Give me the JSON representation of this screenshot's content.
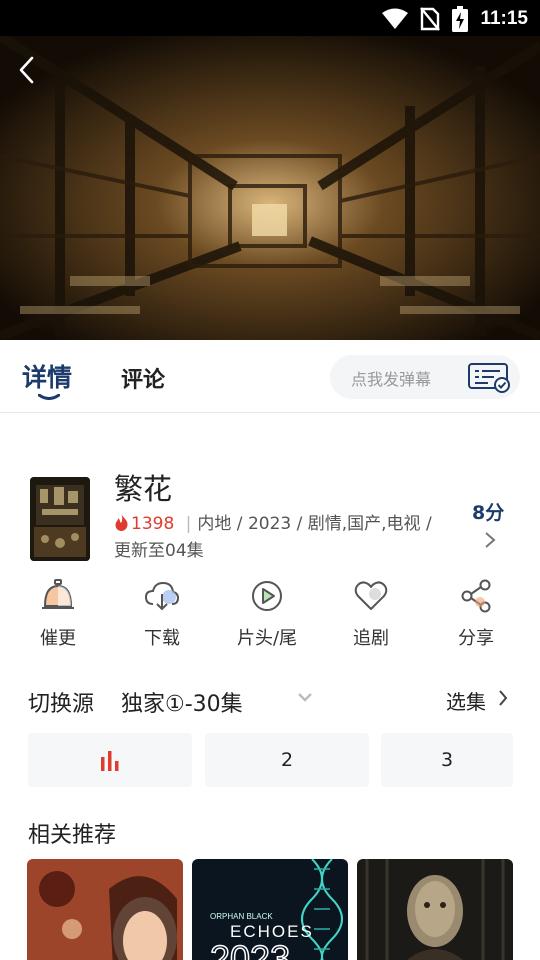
{
  "status_bar": {
    "time": "11:15",
    "icons": [
      "wifi-icon",
      "no-sim-icon",
      "battery-charging-icon"
    ]
  },
  "player": {
    "back_icon": "chevron-left-icon"
  },
  "tabs": [
    {
      "label": "详情",
      "active": true
    },
    {
      "label": "评论",
      "active": false
    }
  ],
  "danmaku": {
    "placeholder": "点我发弹幕",
    "icon": "danmaku-settings-icon"
  },
  "show": {
    "title": "繁花",
    "heat": "1398",
    "meta": "内地 / 2023 / 剧情,国产,电视 /",
    "update_status": "更新至04集",
    "score_label": "8分"
  },
  "actions": [
    {
      "label": "催更",
      "icon": "bell-icon"
    },
    {
      "label": "下载",
      "icon": "cloud-download-icon"
    },
    {
      "label": "片头/尾",
      "icon": "play-circle-icon"
    },
    {
      "label": "追剧",
      "icon": "heart-icon"
    },
    {
      "label": "分享",
      "icon": "share-icon"
    }
  ],
  "source": {
    "label": "切换源",
    "value": "独家①-30集",
    "choose_label": "选集"
  },
  "episodes": [
    {
      "label": "",
      "playing": true,
      "icon": "playing-bars-icon"
    },
    {
      "label": "2"
    },
    {
      "label": "3"
    }
  ],
  "recommended": {
    "title": "相关推荐",
    "card2_caption_small": "ORPHAN BLACK",
    "card2_caption": "ECHOES",
    "card2_number": "2023"
  },
  "colors": {
    "accent_dark_blue": "#1c3a6b",
    "heat_red": "#e03b2e",
    "action_orange": "#f0a070"
  }
}
